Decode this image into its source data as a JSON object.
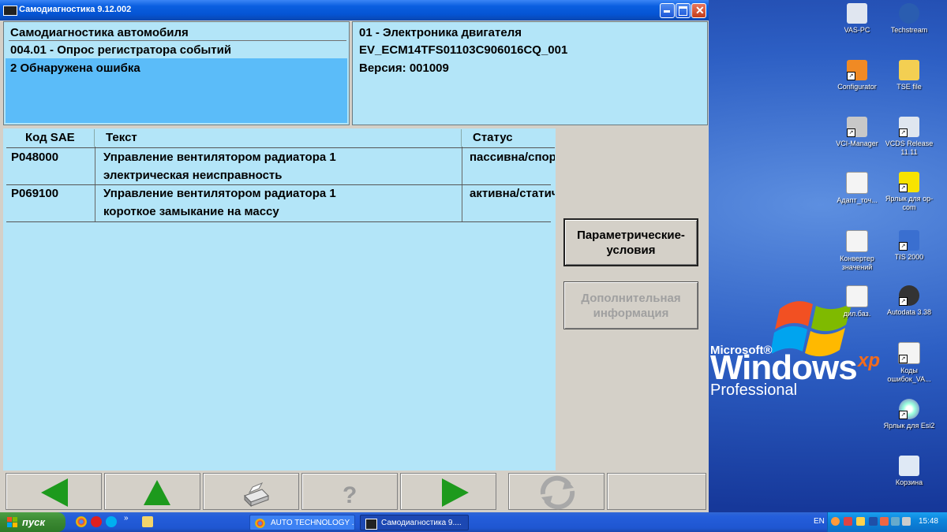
{
  "window": {
    "title": "Самодиагностика 9.12.002"
  },
  "header_left": {
    "line1": "Самодиагностика автомобиля",
    "line2": "004.01 - Опрос регистратора событий",
    "line3": "2 Обнаружена ошибка"
  },
  "header_right": {
    "line1": "01 - Электроника двигателя",
    "line2": "EV_ECM14TFS01103C906016CQ_001",
    "line3": "Версия: 001009"
  },
  "table": {
    "columns": [
      "Код SAE",
      "Текст",
      "Статус"
    ],
    "rows": [
      {
        "code": "P048000",
        "text1": "Управление вентилятором радиатора 1",
        "text2": "электрическая неисправность",
        "status": "пассивна/спорадически"
      },
      {
        "code": "P069100",
        "text1": "Управление вентилятором радиатора 1",
        "text2": "короткое замыкание на массу",
        "status": "активна/статически"
      }
    ]
  },
  "side_buttons": {
    "params_line1": "Параметрические-",
    "params_line2": "условия",
    "extra_line1": "Дополнительная",
    "extra_line2": "информация"
  },
  "toolbar_icons": [
    "arrow-left-icon",
    "arrow-up-icon",
    "printer-icon",
    "help-icon",
    "arrow-right-icon",
    "refresh-icon"
  ],
  "desktop_icons": [
    {
      "label": "VAS-PC",
      "icon": "vas-pc-icon"
    },
    {
      "label": "Techstream",
      "icon": "techstream-icon"
    },
    {
      "label": "Configurator",
      "icon": "configurator-icon"
    },
    {
      "label": "TSE file",
      "icon": "folder-icon"
    },
    {
      "label": "VCI-Manager",
      "icon": "vci-manager-icon"
    },
    {
      "label": "VCDS Release 11.11",
      "icon": "vcds-icon"
    },
    {
      "label": "Адапт_точ...",
      "icon": "document-icon"
    },
    {
      "label": "Ярлык для op-com",
      "icon": "opcom-icon"
    },
    {
      "label": "Конвертер значений",
      "icon": "document-icon"
    },
    {
      "label": "TIS 2000",
      "icon": "tis-icon"
    },
    {
      "label": "дил.баз.",
      "icon": "document-icon"
    },
    {
      "label": "Autodata 3.38",
      "icon": "autodata-icon"
    },
    {
      "label": "Коды ошибок_VA...",
      "icon": "document-icon"
    },
    {
      "label": "Ярлык для Esi2",
      "icon": "cd-icon"
    },
    {
      "label": "Корзина",
      "icon": "recycle-bin-icon"
    }
  ],
  "wallpaper": {
    "brand_ms": "Microsoft®",
    "brand_win": "Windows",
    "brand_xp": "xp",
    "brand_edition": "Professional"
  },
  "taskbar": {
    "start_label": "пуск",
    "tasks": [
      "AUTO TECHNOLOGY ...",
      "Самодиагностика 9...."
    ],
    "language": "EN",
    "clock": "15:48"
  },
  "colors": {
    "panel_bg": "#b3e5f8",
    "selection_bg": "#5bbcf9",
    "arrow_green": "#1d9a1d",
    "titlebar_blue": "#0554d4"
  }
}
